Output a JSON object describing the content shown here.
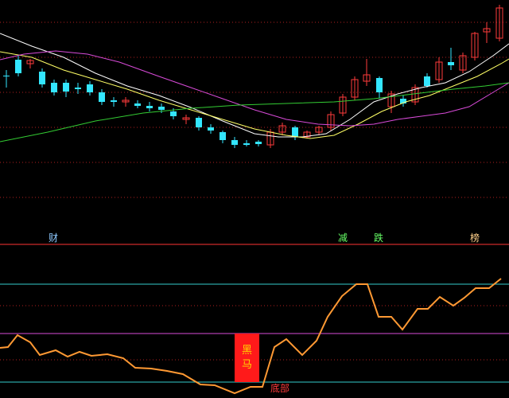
{
  "colors": {
    "background": "#000000",
    "up_candle": "#ff3b3b",
    "down_candle": "#33e6ff",
    "ma_short": "#ffffff",
    "ma_mid": "#ffff66",
    "ma_long1": "#d94bd9",
    "ma_long2": "#33cc33",
    "panel_divider": "#ff3333",
    "grid_dotted": "#b02020",
    "osc_line": "#ff9933",
    "osc_upper": "#33cccc",
    "osc_mid": "#d94bd9",
    "osc_lower": "#33cccc",
    "blackhorse_bg": "#ff1a1a",
    "blackhorse_text": "#ffd400"
  },
  "flags": [
    {
      "text": "财",
      "color": "#8ec9ff"
    },
    {
      "text": "减",
      "color": "#66ff66"
    },
    {
      "text": "跌",
      "color": "#66ff66"
    },
    {
      "text": "榜",
      "color": "#ffd08a"
    }
  ],
  "signal": {
    "black_horse_line1": "黑",
    "black_horse_line2": "马",
    "bottom_label": "底部"
  }
}
